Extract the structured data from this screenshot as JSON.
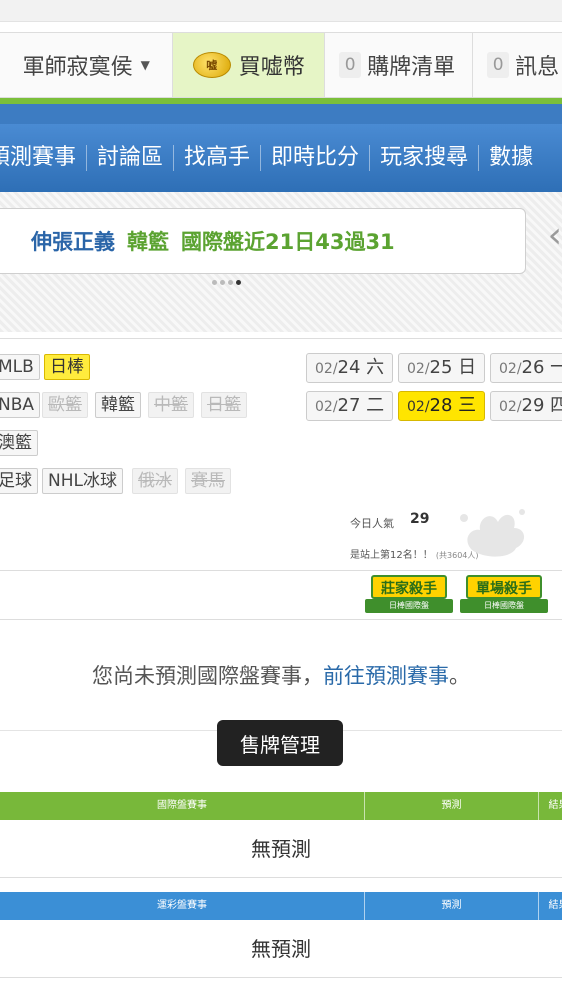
{
  "account": {
    "username": "軍師寂寞侯",
    "coin_badge": "嘘",
    "coin_label": "買嘘幣",
    "cart_count": "0",
    "cart_label": "購牌清單",
    "msg_count": "0",
    "msg_label": "訊息"
  },
  "nav": {
    "items": [
      "預測賽事",
      "討論區",
      "找高手",
      "即時比分",
      "玩家搜尋",
      "數據"
    ]
  },
  "promo": {
    "part1": "伸張正義",
    "part2": "韓籃",
    "part3": "國際盤近21日43過31",
    "next_arrow": "‹"
  },
  "leagues": {
    "row1": [
      "MLB",
      "日棒"
    ],
    "row2": [
      "NBA",
      "歐籃",
      "韓籃",
      "中籃",
      "日籃"
    ],
    "row3": [
      "澳籃"
    ],
    "row4": [
      "足球",
      "NHL冰球",
      "俄冰",
      "賽馬"
    ]
  },
  "dates": [
    {
      "md": "02/",
      "d": "24",
      "wd": "六"
    },
    {
      "md": "02/",
      "d": "25",
      "wd": "日"
    },
    {
      "md": "02/",
      "d": "26",
      "wd": "一"
    },
    {
      "md": "02/",
      "d": "27",
      "wd": "二"
    },
    {
      "md": "02/",
      "d": "28",
      "wd": "三"
    },
    {
      "md": "02/",
      "d": "29",
      "wd": "四"
    }
  ],
  "stats": {
    "popularity_label": "今日人氣",
    "popularity_value": "29",
    "rank_text": "是站上第12名！！",
    "rank_note": "(共3604人)"
  },
  "badges": [
    {
      "title": "莊家殺手",
      "sub": "日棒國際盤"
    },
    {
      "title": "單場殺手",
      "sub": "日棒國際盤"
    }
  ],
  "message": {
    "text": "您尚未預測國際盤賽事，",
    "link": "前往預測賽事",
    "end": "。"
  },
  "sell_button": "售牌管理",
  "tables": {
    "intl": {
      "col_game": "國際盤賽事",
      "col_pred": "預測",
      "col_res": "結果",
      "empty": "無預測"
    },
    "lottery": {
      "col_game": "運彩盤賽事",
      "col_pred": "預測",
      "col_res": "結果",
      "empty": "無預測"
    }
  },
  "colors": {
    "nav_blue": "#2e6fb6",
    "accent_green": "#78b83a",
    "table_blue": "#3b8fd6",
    "highlight_yellow": "#ffe500",
    "link_blue": "#2a6aa9"
  }
}
